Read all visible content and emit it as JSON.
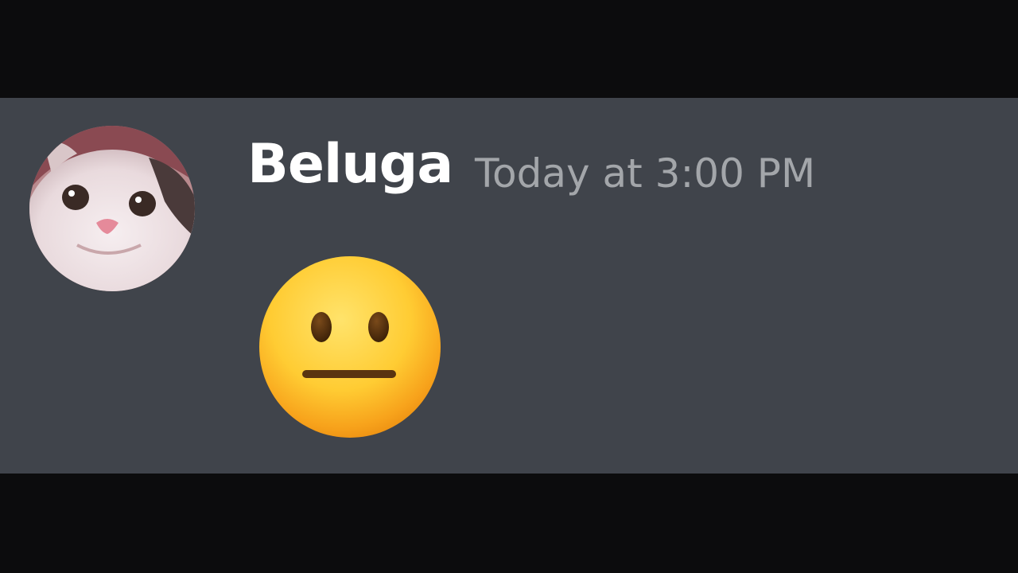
{
  "message": {
    "author": "Beluga",
    "timestamp": "Today at 3:00 PM",
    "content_emoji": "neutral-face-icon"
  },
  "avatar": {
    "icon": "cat-avatar-icon"
  },
  "colors": {
    "background": "#0c0c0d",
    "message_band": "#40444b",
    "author": "#ffffff",
    "timestamp": "#a3a6aa"
  }
}
